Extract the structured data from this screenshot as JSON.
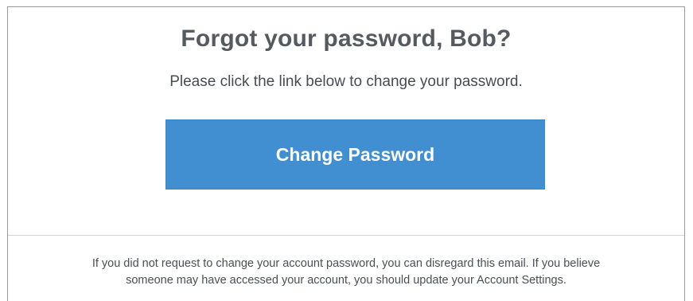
{
  "email": {
    "title": "Forgot your password, Bob?",
    "subtitle": "Please click the link below to change your password.",
    "button_label": "Change Password",
    "footer_line1": "If you did not request to change your account password, you can disregard this email. If you believe",
    "footer_line2": "someone may have accessed your account, you should update your Account Settings."
  },
  "colors": {
    "button_bg": "#418fd0",
    "title_text": "#555a60",
    "body_text": "#474c52"
  }
}
